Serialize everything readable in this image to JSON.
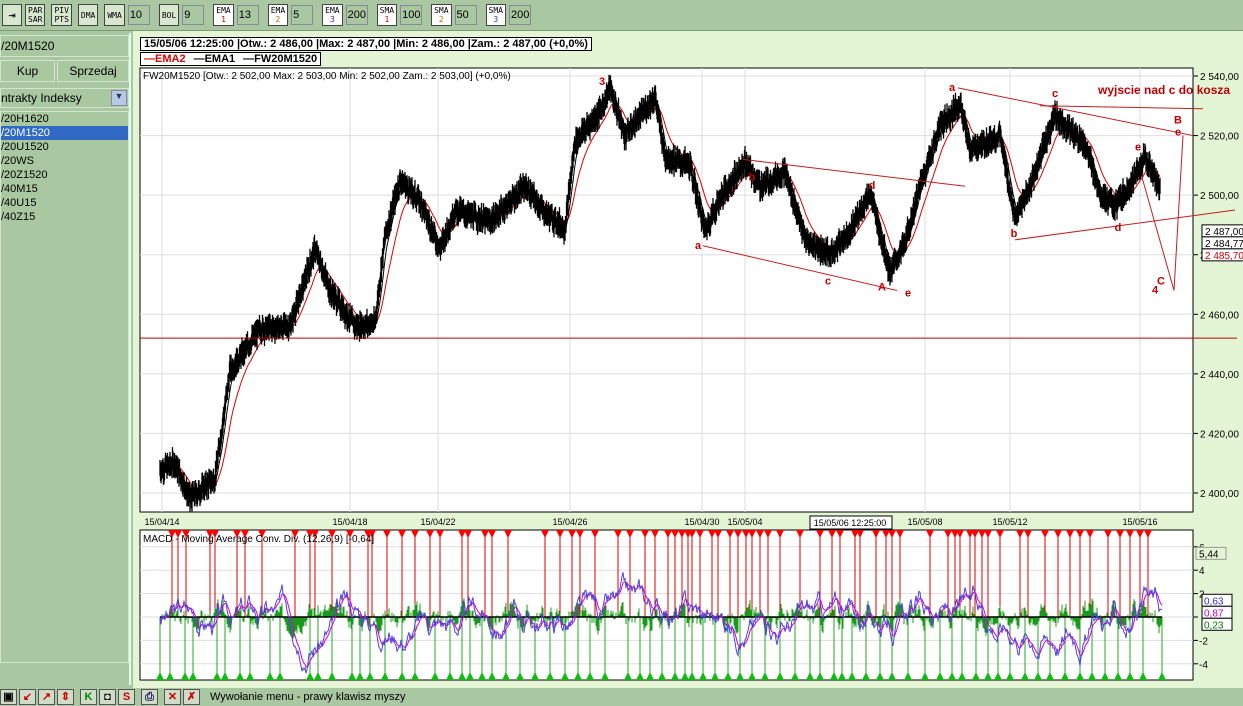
{
  "toolbar": {
    "buttons": [
      {
        "label": "PAR SAR"
      },
      {
        "label": "PIV PTS"
      },
      {
        "label": "DMA"
      },
      {
        "label": "WMA",
        "value": "10"
      },
      {
        "label": "BOL",
        "value": "9"
      },
      {
        "label": "EMA",
        "n": "1",
        "value": "13"
      },
      {
        "label": "EMA",
        "n": "2",
        "value": "5"
      },
      {
        "label": "EMA",
        "n": "3",
        "value": "200"
      },
      {
        "label": "SMA",
        "n": "1",
        "value": "100"
      },
      {
        "label": "SMA",
        "n": "2",
        "value": "50"
      },
      {
        "label": "SMA",
        "n": "3",
        "value": "200"
      }
    ]
  },
  "left": {
    "instrument": "/20M1520",
    "buy": "Kup",
    "sell": "Sprzedaj",
    "category": "ntrakty Indeksy",
    "items": [
      "/20H1620",
      "/20M1520",
      "/20U1520",
      "/20WS",
      "/20Z1520",
      "/40M15",
      "/40U15",
      "/40Z15"
    ],
    "selected": 1
  },
  "info_bar": "15/05/06 12:25:00 |Otw.: 2 486,00 |Max: 2 487,00 |Min: 2 486,00 |Zam.: 2 487,00 (+0,0%)",
  "legend": [
    {
      "label": "EMA2",
      "color": "#e00000"
    },
    {
      "label": "EMA1",
      "color": "#000000"
    },
    {
      "label": "FW20M1520",
      "color": "#000000"
    }
  ],
  "status_text": "Wywołanie menu - prawy klawisz myszy",
  "chart_data": [
    {
      "type": "line",
      "title": "FW20M1520 [Otw.: 2 502,00  Max: 2 503,00  Min: 2 502,00  Zam.: 2 503,00] (+0,0%)",
      "ylim": [
        2390,
        2545
      ],
      "yticks": [
        2400,
        2420,
        2440,
        2460,
        2480,
        2500,
        2520,
        2540
      ],
      "ytick_labels": [
        "2 400,00",
        "2 420,00",
        "2 440,00",
        "2 460,00",
        "2 480,00",
        "2 500,00",
        "2 520,00",
        "2 540,00"
      ],
      "xlim": [
        0,
        1053
      ],
      "xticks": [
        {
          "i": 22,
          "label": "15/04/14"
        },
        {
          "i": 210,
          "label": "15/04/18"
        },
        {
          "i": 298,
          "label": "15/04/22"
        },
        {
          "i": 430,
          "label": "15/04/26"
        },
        {
          "i": 562,
          "label": "15/04/30"
        },
        {
          "i": 605,
          "label": "15/05/04"
        },
        {
          "i": 785,
          "label": "15/05/08"
        },
        {
          "i": 870,
          "label": "15/05/12"
        },
        {
          "i": 1000,
          "label": "15/05/16"
        }
      ],
      "cursor_label": "15/05/06 12:25:00",
      "price": [
        [
          20,
          2408
        ],
        [
          35,
          2410
        ],
        [
          50,
          2398
        ],
        [
          75,
          2405
        ],
        [
          90,
          2441
        ],
        [
          120,
          2455
        ],
        [
          150,
          2456
        ],
        [
          175,
          2482
        ],
        [
          190,
          2468
        ],
        [
          215,
          2456
        ],
        [
          235,
          2457
        ],
        [
          245,
          2486
        ],
        [
          260,
          2505
        ],
        [
          280,
          2498
        ],
        [
          300,
          2482
        ],
        [
          315,
          2495
        ],
        [
          350,
          2491
        ],
        [
          385,
          2503
        ],
        [
          405,
          2494
        ],
        [
          425,
          2489
        ],
        [
          435,
          2518
        ],
        [
          460,
          2528
        ],
        [
          470,
          2536
        ],
        [
          485,
          2520
        ],
        [
          515,
          2533
        ],
        [
          525,
          2513
        ],
        [
          550,
          2510
        ],
        [
          565,
          2488
        ],
        [
          580,
          2499
        ],
        [
          605,
          2511
        ],
        [
          620,
          2503
        ],
        [
          645,
          2508
        ],
        [
          665,
          2485
        ],
        [
          690,
          2480
        ],
        [
          710,
          2488
        ],
        [
          730,
          2501
        ],
        [
          750,
          2474
        ],
        [
          765,
          2484
        ],
        [
          780,
          2503
        ],
        [
          800,
          2523
        ],
        [
          820,
          2531
        ],
        [
          830,
          2515
        ],
        [
          860,
          2520
        ],
        [
          875,
          2492
        ],
        [
          890,
          2503
        ],
        [
          915,
          2527
        ],
        [
          945,
          2517
        ],
        [
          960,
          2501
        ],
        [
          975,
          2496
        ],
        [
          995,
          2506
        ],
        [
          1005,
          2513
        ],
        [
          1020,
          2502
        ]
      ],
      "hline": 2452,
      "ema_values": [
        {
          "label": "2 487,00",
          "color": "#000000"
        },
        {
          "label": "2 484,77",
          "color": "#000000"
        },
        {
          "label": "2 485,70",
          "color": "#d00000"
        }
      ],
      "annotations": [
        {
          "text": "3",
          "i": 462,
          "p": 2537
        },
        {
          "text": "a",
          "i": 558,
          "p": 2482
        },
        {
          "text": "b",
          "i": 612,
          "p": 2505
        },
        {
          "text": "c",
          "i": 688,
          "p": 2470
        },
        {
          "text": "d",
          "i": 732,
          "p": 2502
        },
        {
          "text": "A",
          "i": 742,
          "p": 2468
        },
        {
          "text": "e",
          "i": 768,
          "p": 2466
        },
        {
          "text": "a",
          "i": 812,
          "p": 2535
        },
        {
          "text": "c",
          "i": 915,
          "p": 2533
        },
        {
          "text": "b",
          "i": 874,
          "p": 2486
        },
        {
          "text": "d",
          "i": 978,
          "p": 2488
        },
        {
          "text": "e",
          "i": 998,
          "p": 2515
        },
        {
          "text": "B",
          "i": 1038,
          "p": 2524
        },
        {
          "text": "e",
          "i": 1038,
          "p": 2520
        },
        {
          "text": "C",
          "i": 1021,
          "p": 2470
        },
        {
          "text": "4",
          "i": 1015,
          "p": 2467
        },
        {
          "text": "wyjscie nad  c do kosza",
          "i": 958,
          "p": 2534
        }
      ],
      "lines": [
        [
          [
            563,
            2483
          ],
          [
            757,
            2468
          ]
        ],
        [
          [
            603,
            2512
          ],
          [
            825,
            2503
          ]
        ],
        [
          [
            818,
            2536
          ],
          [
            1053,
            2520
          ]
        ],
        [
          [
            900,
            2530
          ],
          [
            1063,
            2529
          ]
        ],
        [
          [
            875,
            2485
          ],
          [
            1095,
            2495
          ]
        ],
        [
          [
            1002,
            2506
          ],
          [
            1034,
            2468
          ]
        ],
        [
          [
            1034,
            2468
          ],
          [
            1043,
            2520
          ]
        ]
      ]
    },
    {
      "type": "line",
      "title": "MACD - Moving Average Conv. Div. (12,26,9) [-0,64]",
      "ylim": [
        -5.5,
        7
      ],
      "yticks": [
        -4,
        -2,
        0,
        2,
        4,
        6
      ],
      "ytick_labels": [
        "-4",
        "-2",
        "",
        "2",
        "4",
        "6"
      ],
      "marker_value": "5,44",
      "values": [
        {
          "label": "0,63",
          "color": "#3030d0"
        },
        {
          "label": "0,87",
          "color": "#c000c0"
        },
        {
          "label": "0,23",
          "color": "#008000"
        }
      ],
      "sell_signals": [
        32,
        38,
        46,
        70,
        75,
        97,
        105,
        122,
        155,
        170,
        175,
        192,
        210,
        228,
        232,
        247,
        262,
        275,
        290,
        300,
        322,
        328,
        345,
        352,
        368,
        405,
        420,
        432,
        440,
        455,
        478,
        490,
        505,
        515,
        528,
        535,
        542,
        548,
        552,
        560,
        572,
        578,
        590,
        598,
        606,
        612,
        620,
        628,
        640,
        660,
        680,
        692,
        700,
        715,
        720,
        736,
        746,
        752,
        760,
        790,
        808,
        815,
        820,
        830,
        835,
        842,
        848,
        860,
        880,
        888,
        905,
        918,
        930,
        940,
        950,
        968,
        980,
        990,
        1000,
        1008
      ],
      "buy_signals": [
        20,
        30,
        45,
        53,
        77,
        85,
        100,
        110,
        130,
        140,
        170,
        178,
        192,
        212,
        220,
        230,
        245,
        262,
        275,
        295,
        310,
        322,
        330,
        342,
        352,
        366,
        380,
        395,
        410,
        425,
        438,
        450,
        465,
        488,
        500,
        510,
        522,
        535,
        545,
        552,
        563,
        575,
        588,
        600,
        612,
        625,
        640,
        655,
        670,
        680,
        694,
        702,
        712,
        726,
        740,
        752,
        768,
        785,
        800,
        812,
        822,
        836,
        848,
        858,
        870,
        885,
        898,
        910,
        925,
        940,
        952,
        965,
        978,
        990,
        1003,
        1022
      ]
    }
  ]
}
